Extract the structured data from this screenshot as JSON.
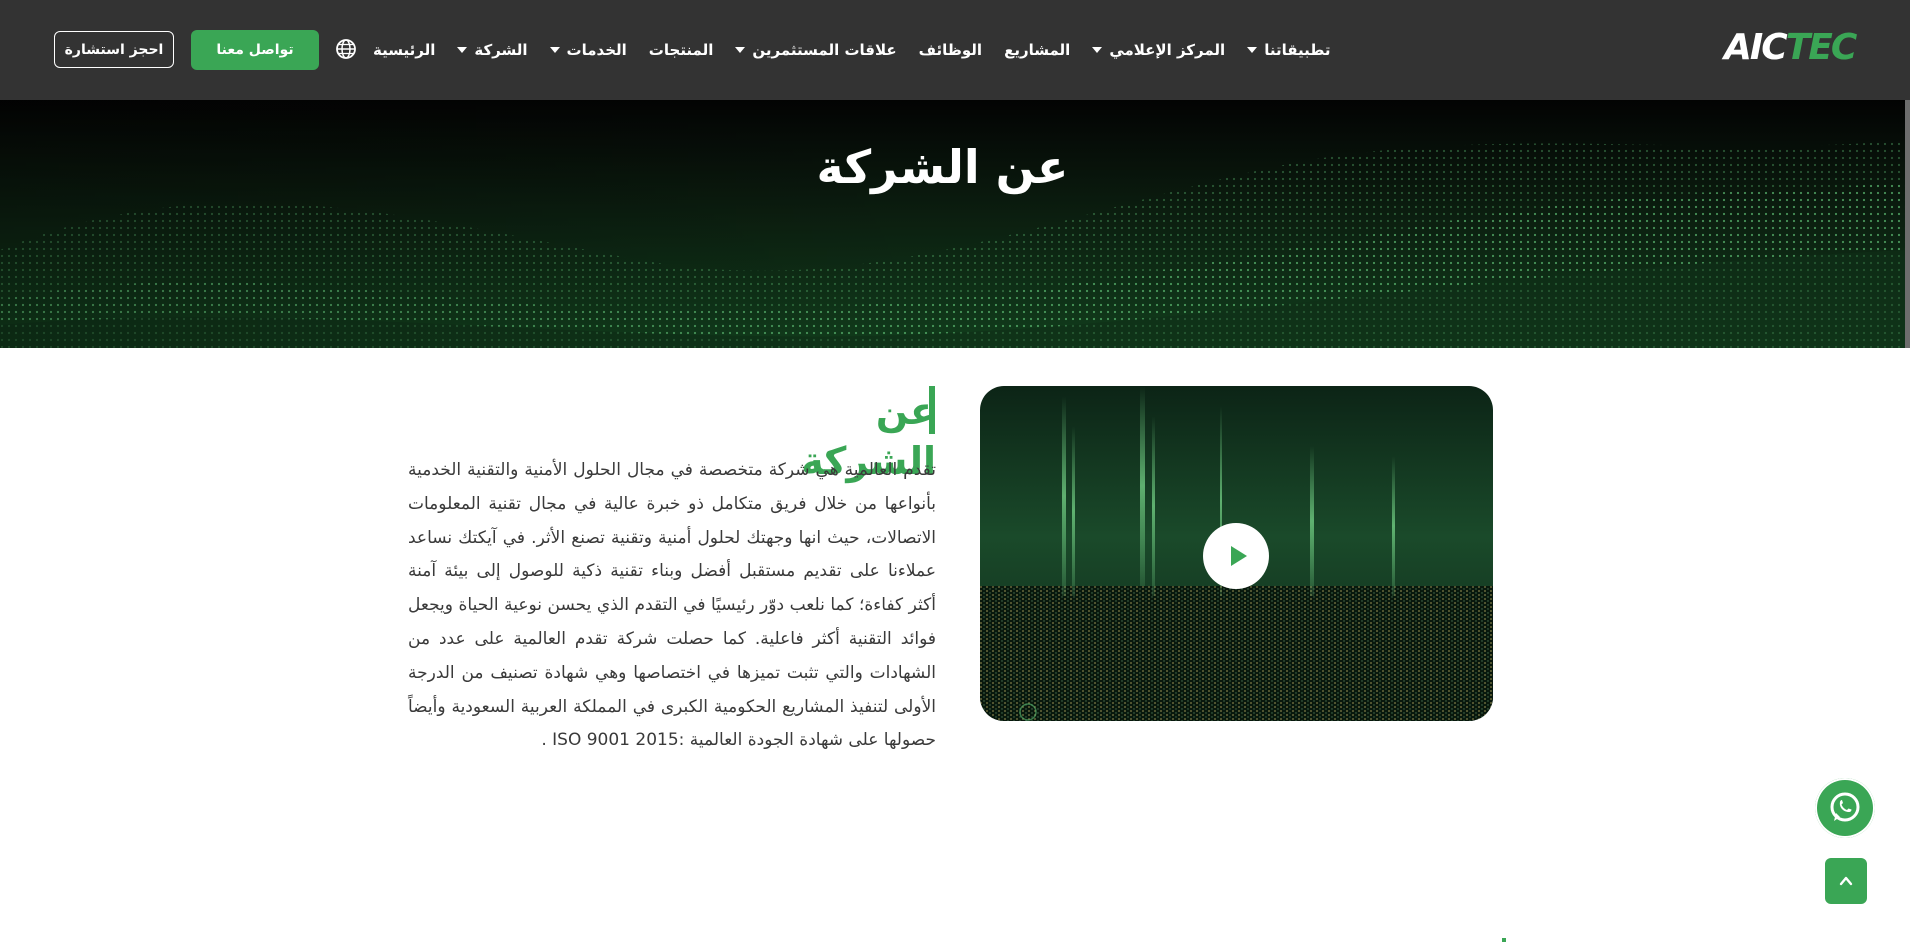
{
  "header": {
    "logo_left": "AIC",
    "logo_right": "TEC",
    "nav": [
      {
        "label": "الرئيسية",
        "dropdown": false
      },
      {
        "label": "الشركة",
        "dropdown": true
      },
      {
        "label": "الخدمات",
        "dropdown": true
      },
      {
        "label": "المنتجات",
        "dropdown": false
      },
      {
        "label": "علاقات المستثمرين",
        "dropdown": true
      },
      {
        "label": "الوظائف",
        "dropdown": false
      },
      {
        "label": "المشاريع",
        "dropdown": false
      },
      {
        "label": "المركز الإعلامي",
        "dropdown": true
      },
      {
        "label": "تطبيقاتنا",
        "dropdown": true
      }
    ],
    "language_icon": "globe-icon",
    "contact_button": "تواصل معنا",
    "consult_button": "احجز استشارة"
  },
  "hero": {
    "title": "عن الشركة"
  },
  "about": {
    "title": "عن الشركة",
    "body": "تقدم العالمية هي شركة متخصصة في مجال الحلول الأمنية والتقنية الخدمية بأنواعها من خلال فريق متكامل ذو خبرة عالية في مجال تقنية المعلومات الاتصالات، حيث انها وجهتك لحلول أمنية وتقنية تصنع الأثر. في آيكتك نساعد عملاءنا على تقديم مستقبل أفضل وبناء تقنية ذكية للوصول إلى بيئة آمنة أكثر كفاءة؛ كما نلعب دوّر رئيسيًا في التقدم الذي يحسن نوعية الحياة ويجعل فوائد التقنية أكثر فاعلية. كما حصلت شركة تقدم العالمية على عدد من الشهادات والتي تثبت تميزها في اختصاصها وهي شهادة تصنيف من الدرجة الأولى لتنفيذ المشاريع الحكومية الكبرى في المملكة العربية السعودية وأيضاً حصولها على شهادة الجودة العالمية :ISO 9001 2015 ."
  },
  "floating": {
    "whatsapp_icon": "whatsapp-icon",
    "back_to_top_icon": "chevron-up-icon"
  },
  "colors": {
    "header_bg": "#333333",
    "accent": "#3aa655",
    "text": "#3a3a3a"
  }
}
